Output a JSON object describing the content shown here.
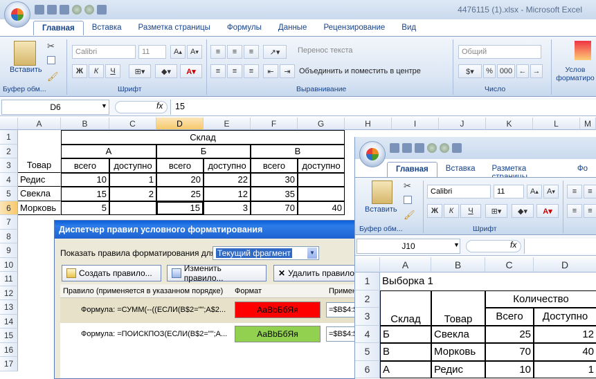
{
  "main": {
    "title": "4476115 (1).xlsx - Microsoft Excel",
    "tabs": [
      "Главная",
      "Вставка",
      "Разметка страницы",
      "Формулы",
      "Данные",
      "Рецензирование",
      "Вид"
    ],
    "ribbon": {
      "clipboard_label": "Буфер обм...",
      "paste_label": "Вставить",
      "font_label": "Шрифт",
      "font_name": "Calibri",
      "font_size": "11",
      "bold": "Ж",
      "italic": "К",
      "underline": "Ч",
      "align_label": "Выравнивание",
      "wrap_text": "Перенос текста",
      "merge_center": "Объединить и поместить в центре",
      "number_label": "Число",
      "number_format": "Общий",
      "pct": "%",
      "thousand": "000",
      "cond_format": "Услов форматиро"
    },
    "name_box": "D6",
    "fx": "fx",
    "formula": "15",
    "col_headers": [
      "A",
      "B",
      "C",
      "D",
      "E",
      "F",
      "G",
      "H",
      "I",
      "J",
      "K",
      "L",
      "M"
    ],
    "row_headers": [
      "1",
      "2",
      "3",
      "4",
      "5",
      "6",
      "7",
      "8",
      "9",
      "10",
      "11",
      "12",
      "13",
      "14",
      "15",
      "16",
      "17"
    ],
    "cells": {
      "sklad": "Склад",
      "a": "А",
      "b": "Б",
      "v": "В",
      "tovar": "Товар",
      "vsego": "всего",
      "dostupno": "доступно",
      "r4": [
        "Редис",
        "10",
        "1",
        "20",
        "22",
        "30",
        ""
      ],
      "r5": [
        "Свекла",
        "15",
        "2",
        "25",
        "12",
        "35",
        ""
      ],
      "r6": [
        "Морковь",
        "5",
        "",
        "15",
        "3",
        "70",
        "40"
      ]
    }
  },
  "dialog": {
    "title": "Диспетчер правил условного форматирования",
    "show_label": "Показать правила форматирования для:",
    "show_value": "Текущий фрагмент",
    "create": "Создать правило...",
    "edit": "Изменить правило...",
    "delete": "Удалить правило",
    "col_rule": "Правило (применяется в указанном порядке)",
    "col_format": "Формат",
    "col_applies": "Примен",
    "rule1": "Формула: =СУММ(--((ЕСЛИ(B$2=\"\";A$2...",
    "rule1_fmt": "АаВbБбЯя",
    "rule1_apply": "=$B$4:$",
    "rule2": "Формула: =ПОИСКПОЗ(ЕСЛИ(B$2=\"\";A...",
    "rule2_fmt": "АаВbБбЯя",
    "rule2_apply": "=$B$4:$",
    "colors": {
      "rule1": "#ff0000",
      "rule2": "#92d050"
    }
  },
  "second": {
    "tabs": [
      "Главная",
      "Вставка",
      "Разметка страницы",
      "Фо"
    ],
    "clipboard_label": "Буфер обм...",
    "paste_label": "Вставить",
    "font_label": "Шрифт",
    "font_name": "Calibri",
    "font_size": "11",
    "bold": "Ж",
    "italic": "К",
    "underline": "Ч",
    "name_box": "J10",
    "fx": "fx",
    "col_headers": [
      "A",
      "B",
      "C",
      "D"
    ],
    "row_headers": [
      "1",
      "2",
      "3",
      "4",
      "5",
      "6"
    ],
    "cells": {
      "title": "Выборка 1",
      "kolichestvo": "Количество",
      "sklad": "Склад",
      "tovar": "Товар",
      "vsego": "Всего",
      "dostupno": "Доступно",
      "r4": [
        "Б",
        "Свекла",
        "25",
        "12"
      ],
      "r5": [
        "В",
        "Морковь",
        "70",
        "40"
      ],
      "r6": [
        "А",
        "Редис",
        "10",
        "1"
      ]
    }
  }
}
